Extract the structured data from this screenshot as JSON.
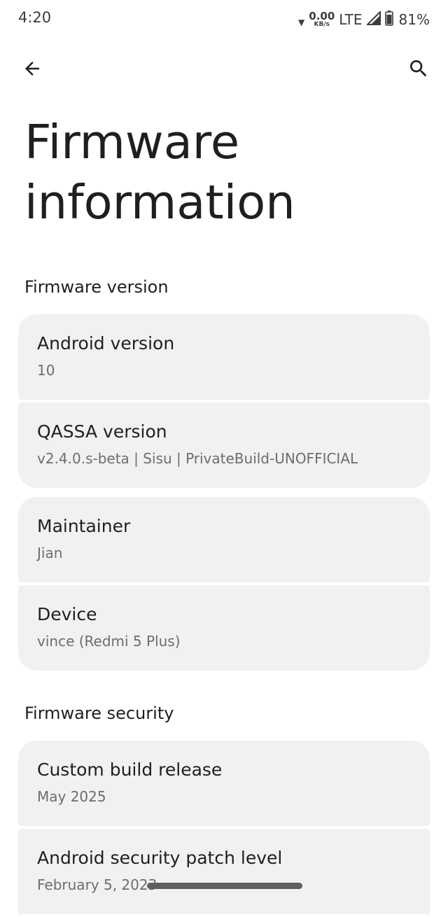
{
  "status_bar": {
    "time": "4:20",
    "net_speed_value": "0.00",
    "net_speed_unit": "KB/s",
    "network_type": "LTE",
    "battery": "81%"
  },
  "icons": {
    "back": "arrow-back-icon",
    "search": "search-icon",
    "signal": "signal-icon",
    "battery": "battery-icon",
    "wifi_activity": "data-activity-icon"
  },
  "page": {
    "title": "Firmware information"
  },
  "sections": {
    "version": {
      "header": "Firmware version",
      "groups": [
        [
          {
            "title": "Android version",
            "summary": "10"
          },
          {
            "title": "QASSA version",
            "summary": "v2.4.0.s-beta | Sisu | PrivateBuild-UNOFFICIAL"
          }
        ],
        [
          {
            "title": "Maintainer",
            "summary": "Jian"
          },
          {
            "title": "Device",
            "summary": "vince (Redmi 5 Plus)"
          }
        ]
      ]
    },
    "security": {
      "header": "Firmware security",
      "groups": [
        [
          {
            "title": "Custom build release",
            "summary": "May 2025"
          },
          {
            "title": "Android security patch level",
            "summary": "February 5, 2023"
          }
        ]
      ]
    }
  },
  "colors": {
    "card_background": "#f1f1f3",
    "summary_text": "#6d6d6d",
    "title_text": "#1f1f1f"
  }
}
